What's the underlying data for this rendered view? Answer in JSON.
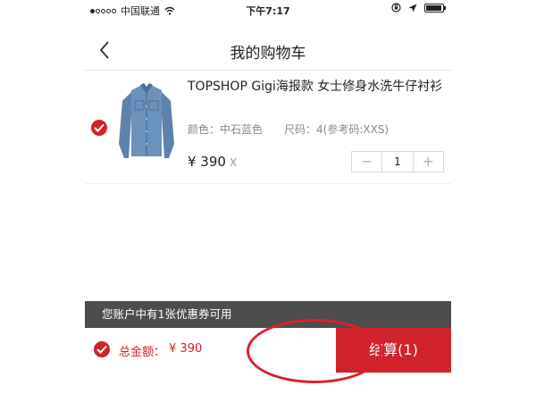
{
  "status_bar": {
    "carrier": "中国联通",
    "time": "下午7:17",
    "icons": [
      "signal-dots-icon",
      "wifi-icon",
      "rotation-lock-icon",
      "location-arrow-icon",
      "battery-icon"
    ]
  },
  "nav": {
    "title": "我的购物车",
    "back_icon": "chevron-left-icon"
  },
  "cart_item": {
    "selected": true,
    "name": "TOPSHOP Gigi海报款 女士修身水洗牛仔衬衫",
    "color_label": "颜色：中石蓝色",
    "size_label": "尺码：4(参考码:XXS)",
    "price": "¥ 390",
    "times": "X",
    "quantity": "1",
    "minus": "−",
    "plus": "+",
    "image": "denim-shirt-image"
  },
  "coupon_banner": {
    "text": "您账户中有1张优惠券可用"
  },
  "footer": {
    "total_label": "总金额：",
    "total_value": "¥ 390",
    "checkout_label": "结算(1)"
  },
  "colors": {
    "accent": "#d0232c",
    "banner": "#4d4d4d",
    "highlight_ring": "#e01e28"
  }
}
